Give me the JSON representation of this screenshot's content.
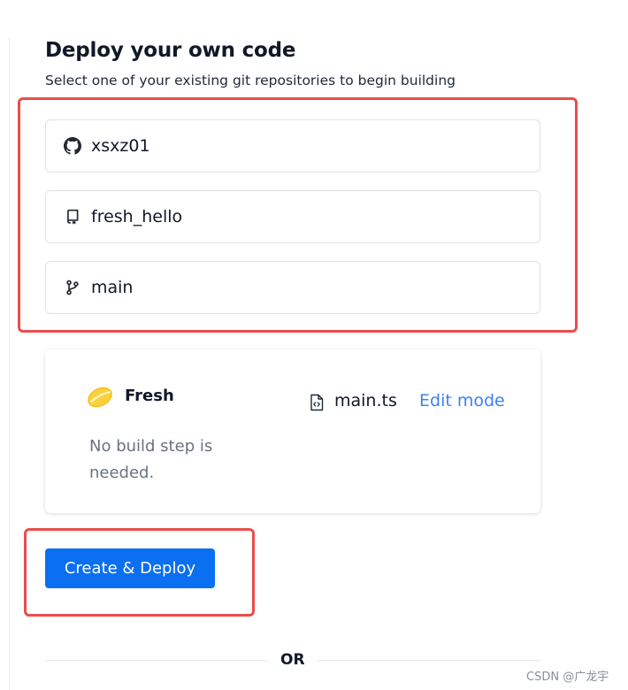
{
  "header": {
    "title": "Deploy your own code",
    "subtitle": "Select one of your existing git repositories to begin building"
  },
  "repo_selectors": [
    {
      "icon": "github-icon",
      "value": "xsxz01"
    },
    {
      "icon": "repo-icon",
      "value": "fresh_hello"
    },
    {
      "icon": "git-branch-icon",
      "value": "main"
    }
  ],
  "build_preset": {
    "framework_icon": "fresh-lemon-icon",
    "framework": "Fresh",
    "description": "No build step is needed.",
    "entrypoint_icon": "code-file-icon",
    "entrypoint": "main.ts",
    "edit_label": "Edit mode"
  },
  "actions": {
    "deploy_label": "Create & Deploy"
  },
  "divider": {
    "label": "OR"
  },
  "watermark": "CSDN @广龙宇",
  "colors": {
    "primary_button": "#0a6ff0",
    "link": "#3b82f6",
    "highlight_border": "#ea4d4b",
    "lemon": "#fbd23d"
  }
}
